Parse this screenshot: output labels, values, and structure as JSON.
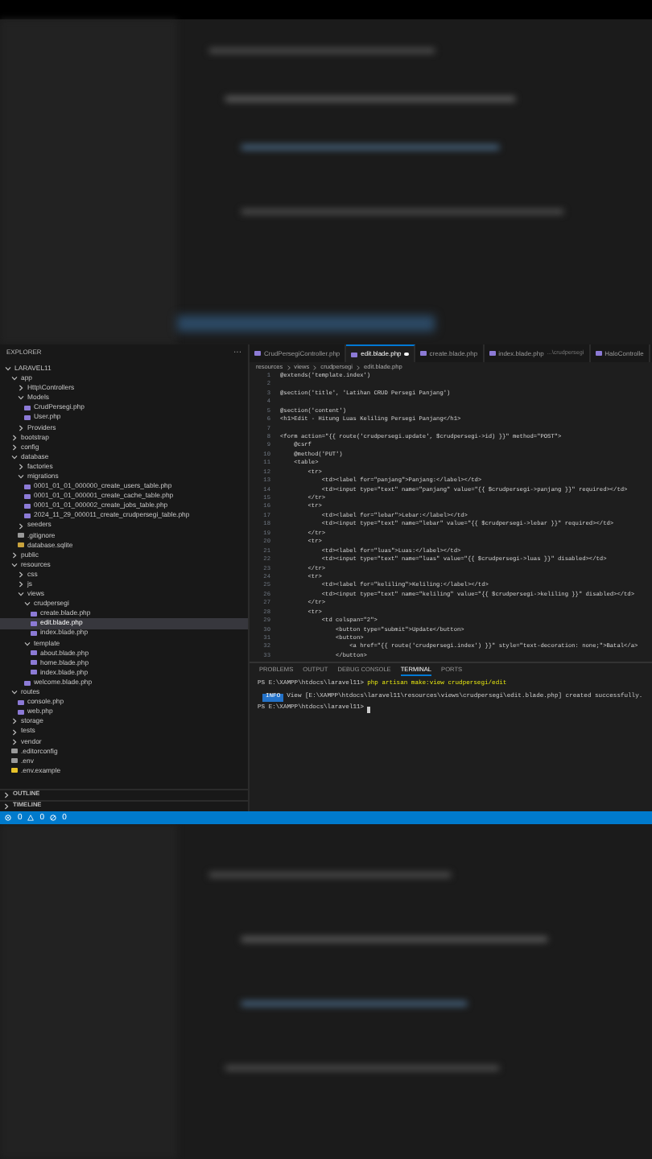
{
  "explorer": {
    "title": "EXPLORER",
    "more": "···",
    "tree": [
      {
        "label": "LARAVEL11",
        "kind": "folder",
        "expanded": true,
        "selected": false,
        "children": [
          {
            "label": "app",
            "kind": "folder",
            "expanded": true,
            "selected": false,
            "children": [
              {
                "label": "Http\\Controllers",
                "kind": "folder",
                "expanded": false,
                "selected": false
              },
              {
                "label": "Models",
                "kind": "folder",
                "expanded": true,
                "selected": false,
                "children": [
                  {
                    "label": "CrudPersegi.php",
                    "kind": "php",
                    "selected": false
                  },
                  {
                    "label": "User.php",
                    "kind": "php",
                    "selected": false
                  }
                ]
              },
              {
                "label": "Providers",
                "kind": "folder",
                "expanded": false,
                "selected": false
              }
            ]
          },
          {
            "label": "bootstrap",
            "kind": "folder",
            "expanded": false,
            "selected": false
          },
          {
            "label": "config",
            "kind": "folder",
            "expanded": false,
            "selected": false
          },
          {
            "label": "database",
            "kind": "folder",
            "expanded": true,
            "selected": false,
            "children": [
              {
                "label": "factories",
                "kind": "folder",
                "expanded": false,
                "selected": false
              },
              {
                "label": "migrations",
                "kind": "folder",
                "expanded": true,
                "selected": false,
                "children": [
                  {
                    "label": "0001_01_01_000000_create_users_table.php",
                    "kind": "php",
                    "selected": false
                  },
                  {
                    "label": "0001_01_01_000001_create_cache_table.php",
                    "kind": "php",
                    "selected": false
                  },
                  {
                    "label": "0001_01_01_000002_create_jobs_table.php",
                    "kind": "php",
                    "selected": false
                  },
                  {
                    "label": "2024_11_29_000011_create_crudpersegi_table.php",
                    "kind": "php",
                    "selected": false
                  }
                ]
              },
              {
                "label": "seeders",
                "kind": "folder",
                "expanded": false,
                "selected": false
              },
              {
                "label": ".gitignore",
                "kind": "config",
                "selected": false
              },
              {
                "label": "database.sqlite",
                "kind": "db",
                "selected": false
              }
            ]
          },
          {
            "label": "public",
            "kind": "folder",
            "expanded": false,
            "selected": false
          },
          {
            "label": "resources",
            "kind": "folder",
            "expanded": true,
            "selected": false,
            "children": [
              {
                "label": "css",
                "kind": "folder",
                "expanded": false,
                "selected": false
              },
              {
                "label": "js",
                "kind": "folder",
                "expanded": false,
                "selected": false
              },
              {
                "label": "views",
                "kind": "folder",
                "expanded": true,
                "selected": false,
                "children": [
                  {
                    "label": "crudpersegi",
                    "kind": "folder",
                    "expanded": true,
                    "selected": false,
                    "children": [
                      {
                        "label": "create.blade.php",
                        "kind": "php",
                        "selected": false
                      },
                      {
                        "label": "edit.blade.php",
                        "kind": "php",
                        "selected": true
                      },
                      {
                        "label": "index.blade.php",
                        "kind": "php",
                        "selected": false
                      }
                    ]
                  },
                  {
                    "label": "template",
                    "kind": "folder",
                    "expanded": true,
                    "selected": false,
                    "children": [
                      {
                        "label": "about.blade.php",
                        "kind": "php",
                        "selected": false
                      },
                      {
                        "label": "home.blade.php",
                        "kind": "php",
                        "selected": false
                      },
                      {
                        "label": "index.blade.php",
                        "kind": "php",
                        "selected": false
                      }
                    ]
                  },
                  {
                    "label": "welcome.blade.php",
                    "kind": "php",
                    "selected": false
                  }
                ]
              }
            ]
          },
          {
            "label": "routes",
            "kind": "folder",
            "expanded": true,
            "selected": false,
            "children": [
              {
                "label": "console.php",
                "kind": "php",
                "selected": false
              },
              {
                "label": "web.php",
                "kind": "php",
                "selected": false
              }
            ]
          },
          {
            "label": "storage",
            "kind": "folder",
            "expanded": false,
            "selected": false
          },
          {
            "label": "tests",
            "kind": "folder",
            "expanded": false,
            "selected": false
          },
          {
            "label": "vendor",
            "kind": "folder",
            "expanded": false,
            "selected": false
          },
          {
            "label": ".editorconfig",
            "kind": "config",
            "selected": false
          },
          {
            "label": ".env",
            "kind": "config",
            "selected": false
          },
          {
            "label": ".env.example",
            "kind": "env",
            "selected": false
          }
        ]
      }
    ],
    "sections": [
      {
        "label": "OUTLINE",
        "expanded": false
      },
      {
        "label": "TIMELINE",
        "expanded": false
      }
    ]
  },
  "tabs": [
    {
      "label": "CrudPersegiController.php",
      "selected": false,
      "modified": false
    },
    {
      "label": "edit.blade.php",
      "selected": true,
      "modified": true
    },
    {
      "label": "create.blade.php",
      "selected": false,
      "modified": false
    },
    {
      "label": "index.blade.php",
      "hint": "...\\crudpersegi",
      "selected": false,
      "modified": false
    },
    {
      "label": "HaloControlle",
      "selected": false,
      "modified": false
    }
  ],
  "breadcrumb": [
    "resources",
    "views",
    "crudpersegi",
    "edit.blade.php"
  ],
  "code": [
    {
      "number": "1",
      "text": "@extends('template.index')"
    },
    {
      "number": "2"
    },
    {
      "number": "3",
      "text": "@section('title', 'Latihan CRUD Persegi Panjang')"
    },
    {
      "number": "4"
    },
    {
      "number": "5",
      "text": "@section('content')"
    },
    {
      "number": "6",
      "text": "<h1>Edit - Hitung Luas Keliling Persegi Panjang</h1>"
    },
    {
      "number": "7"
    },
    {
      "number": "8",
      "text": "<form action=\"{{ route('crudpersegi.update', $crudpersegi->id) }}\" method=\"POST\">"
    },
    {
      "number": "9",
      "text": "    @csrf"
    },
    {
      "number": "10",
      "text": "    @method('PUT')"
    },
    {
      "number": "11",
      "text": "    <table>"
    },
    {
      "number": "12",
      "text": "        <tr>"
    },
    {
      "number": "13",
      "text": "            <td><label for=\"panjang\">Panjang:</label></td>"
    },
    {
      "number": "14",
      "text": "            <td><input type=\"text\" name=\"panjang\" value=\"{{ $crudpersegi->panjang }}\" required></td>"
    },
    {
      "number": "15",
      "text": "        </tr>"
    },
    {
      "number": "16",
      "text": "        <tr>"
    },
    {
      "number": "17",
      "text": "            <td><label for=\"lebar\">Lebar:</label></td>"
    },
    {
      "number": "18",
      "text": "            <td><input type=\"text\" name=\"lebar\" value=\"{{ $crudpersegi->lebar }}\" required></td>"
    },
    {
      "number": "19",
      "text": "        </tr>"
    },
    {
      "number": "20",
      "text": "        <tr>"
    },
    {
      "number": "21",
      "text": "            <td><label for=\"luas\">Luas:</label></td>"
    },
    {
      "number": "22",
      "text": "            <td><input type=\"text\" name=\"luas\" value=\"{{ $crudpersegi->luas }}\" disabled></td>"
    },
    {
      "number": "23",
      "text": "        </tr>"
    },
    {
      "number": "24",
      "text": "        <tr>"
    },
    {
      "number": "25",
      "text": "            <td><label for=\"keliling\">Keliling:</label></td>"
    },
    {
      "number": "26",
      "text": "            <td><input type=\"text\" name=\"keliling\" value=\"{{ $crudpersegi->keliling }}\" disabled></td>"
    },
    {
      "number": "27",
      "text": "        </tr>"
    },
    {
      "number": "28",
      "text": "        <tr>"
    },
    {
      "number": "29",
      "text": "            <td colspan=\"2\">"
    },
    {
      "number": "30",
      "text": "                <button type=\"submit\">Update</button>"
    },
    {
      "number": "31",
      "text": "                <button>"
    },
    {
      "number": "32",
      "text": "                    <a href=\"{{ route('crudpersegi.index') }}\" style=\"text-decoration: none;\">Batal</a>"
    },
    {
      "number": "33",
      "text": "                </button>"
    }
  ],
  "panel_tabs": [
    {
      "label": "PROBLEMS",
      "selected": false
    },
    {
      "label": "OUTPUT",
      "selected": false
    },
    {
      "label": "DEBUG CONSOLE",
      "selected": false
    },
    {
      "label": "TERMINAL",
      "selected": true
    },
    {
      "label": "PORTS",
      "selected": false
    }
  ],
  "terminal": [
    {
      "kind": "command",
      "prompt": "PS E:\\XAMPP\\htdocs\\laravel11>",
      "command": "php artisan make:view crudpersegi/edit"
    },
    {
      "kind": "info",
      "badge": "INFO",
      "text": "View [E:\\XAMPP\\htdocs\\laravel11\\resources\\views\\crudpersegi\\edit.blade.php] created successfully."
    },
    {
      "kind": "prompt",
      "prompt": "PS E:\\XAMPP\\htdocs\\laravel11>"
    }
  ],
  "status_bar": {
    "errors": "0",
    "warnings": "0",
    "ports": "0"
  }
}
